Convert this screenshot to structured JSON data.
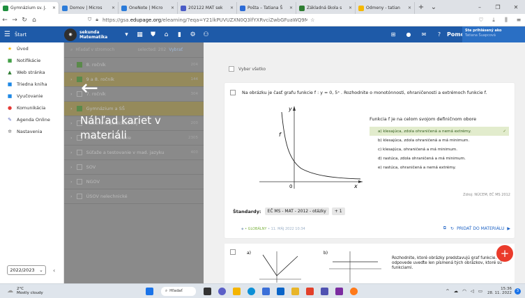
{
  "tabs": [
    {
      "label": "Gymnázium sv. J.",
      "color": "#1e8e3e",
      "active": true
    },
    {
      "label": "Domov | Micros",
      "color": "#2b7bd9",
      "active": false
    },
    {
      "label": "OneNote | Micro",
      "color": "#2b7bd9",
      "active": false
    },
    {
      "label": "202122 MAT sek",
      "color": "#4a5cc7",
      "active": false
    },
    {
      "label": "Pošta – Tatiana Š",
      "color": "#2b6bd6",
      "active": false
    },
    {
      "label": "Základná škola s",
      "color": "#2e7d32",
      "active": false
    },
    {
      "label": "Odmeny - tatian",
      "color": "#f5b800",
      "active": false
    }
  ],
  "address": {
    "prefix": "https://gsa.",
    "domain": "edupage.org",
    "path": "/elearning/?eqa=Y21lkPUVUZXN0Q3lfYXRvciZwbGFuaWQ9MzI1MSZ0ZXN0aWQ9Inl"
  },
  "appbar": {
    "start": "Štart",
    "course_line1": "sekunda",
    "course_line2": "Matematika",
    "help": "Pomoc",
    "user_line1": "Ste prihlásený ako",
    "user_line2": "Tatiana Šuapcová"
  },
  "sidebar": [
    {
      "label": "Úvod",
      "icon": "★",
      "color": "#f5b800"
    },
    {
      "label": "Notifikácie",
      "icon": "■",
      "color": "#43a047"
    },
    {
      "label": "Web stránka",
      "icon": "▲",
      "color": "#2e7d32"
    },
    {
      "label": "Triedna kniha",
      "icon": "■",
      "color": "#1e88e5"
    },
    {
      "label": "Vyučovanie",
      "icon": "■",
      "color": "#1e88e5"
    },
    {
      "label": "Komunikácia",
      "icon": "●",
      "color": "#e53935"
    },
    {
      "label": "Agenda Online",
      "icon": "✎",
      "color": "#5c6bc0"
    },
    {
      "label": "Nastavenia",
      "icon": "✲",
      "color": "#777"
    }
  ],
  "year": "2022/2023",
  "tree": {
    "search": "Hľadať v stromoch",
    "selected": "selected: 202",
    "select_link": "Vybrať",
    "rows": [
      {
        "label": "8. ročník",
        "count": "204",
        "checked": true,
        "sel": false
      },
      {
        "label": "9 a 8. ročník",
        "count": "144",
        "checked": true,
        "sel": true
      },
      {
        "label": "7. ročník",
        "count": "304",
        "checked": false,
        "sel": false
      },
      {
        "label": "Gymnázium a SŠ",
        "count": "",
        "checked": true,
        "sel": true
      },
      {
        "label": "Maturitné podkladovky",
        "count": "200",
        "checked": false,
        "sel": false
      },
      {
        "label": "Súťaže a testovanie",
        "count": "2305",
        "checked": false,
        "sel": false
      },
      {
        "label": "Súťaže a testovanie v mad. jazyku",
        "count": "400",
        "checked": false,
        "sel": false
      },
      {
        "label": "SOV",
        "count": "",
        "checked": false,
        "sel": false
      },
      {
        "label": "NGOV",
        "count": "",
        "checked": false,
        "sel": false
      },
      {
        "label": "ÚSOV nelechnické",
        "count": "",
        "checked": false,
        "sel": false
      }
    ]
  },
  "overlay_title": "Náhľad kariet v materiáli",
  "select_all": "Vyber všetko",
  "question": {
    "text": "Na obrázku je časť grafu funkcie f : y = 0, 5ˣ . Rozhodnite o monotónnosti, ohraničenosti a extrémoch funkcie f.",
    "intro": "Funkcia f je na celom svojom definičnom obore",
    "options": [
      {
        "label": "a)  klesajúca, zdola ohraničená a nemá extrémy.",
        "hl": true
      },
      {
        "label": "b)  klesajúca, zdola ohraničená a má minimum.",
        "hl": false
      },
      {
        "label": "c)  klesajúca, ohraničená a má minimum.",
        "hl": false
      },
      {
        "label": "d)  rastúca, zdola ohraničená a má minimum.",
        "hl": false
      },
      {
        "label": "e)  rastúca, ohraničená a nemá extrémy.",
        "hl": false
      }
    ],
    "source": "Zdroj: NÚCEM, EČ MS 2012",
    "std_label": "Štandardy:",
    "std_badge": "EČ MS - MAT - 2012 - otázky",
    "std_plus": "+ 1",
    "meta_tag": "• GLOBÁLNY",
    "meta_date": "• 11. MÁJ 2022 10:34",
    "add_label": "PRIDAŤ DO MATERIÁLU"
  },
  "graph": {
    "x": "x",
    "y": "y",
    "f": "f",
    "zero": "0"
  },
  "question2": {
    "text": "Rozhodnite, ktoré obrázky predstavujú graf funkcie. V odpovede uveďte len písmená tých obrázkov, ktoré sú funkciami.",
    "a": "a)",
    "b": "b)"
  },
  "taskbar": {
    "temp": "2°C",
    "weather": "Mostly cloudy",
    "search": "Hľadať",
    "time": "15:36",
    "date": "28. 11. 2022",
    "notif": "3"
  }
}
